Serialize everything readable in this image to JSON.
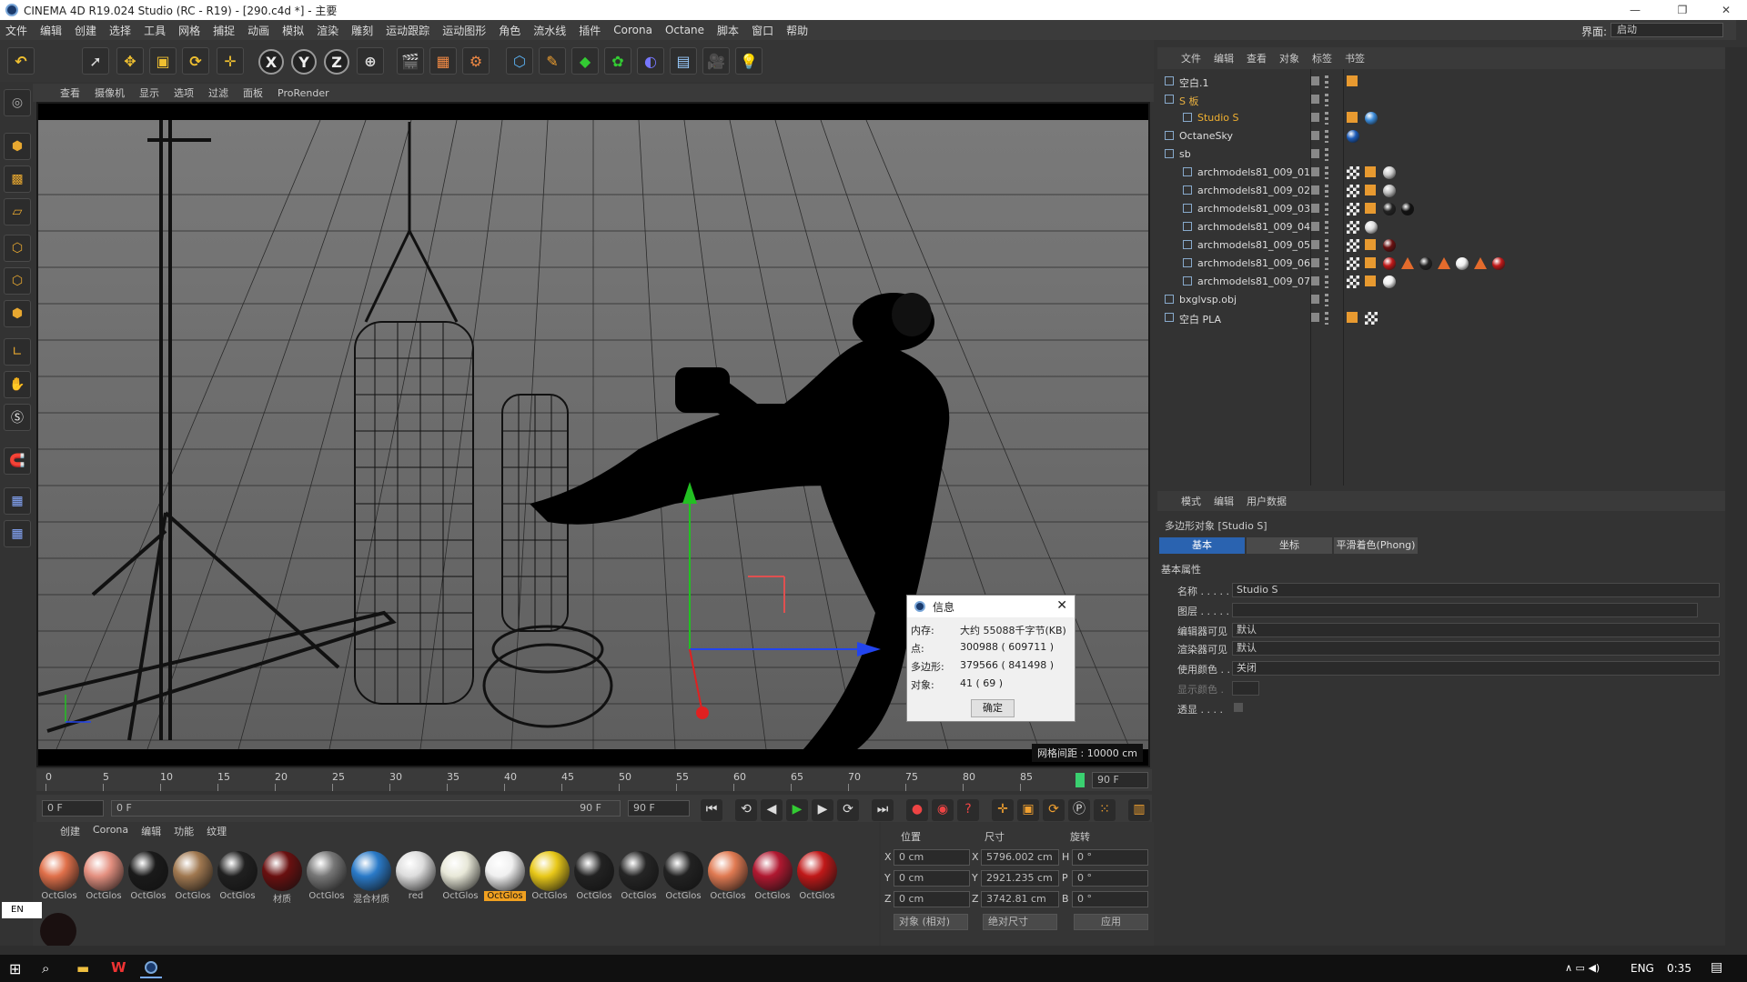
{
  "window": {
    "title": "CINEMA 4D R19.024 Studio (RC - R19) - [290.c4d *] - 主要"
  },
  "menubar": [
    "文件",
    "编辑",
    "创建",
    "选择",
    "工具",
    "网格",
    "捕捉",
    "动画",
    "模拟",
    "渲染",
    "雕刻",
    "运动跟踪",
    "运动图形",
    "角色",
    "流水线",
    "插件",
    "Corona",
    "Octane",
    "脚本",
    "窗口",
    "帮助"
  ],
  "interface": {
    "label": "界面:",
    "value": "启动"
  },
  "viewport_menu": [
    "查看",
    "摄像机",
    "显示",
    "选项",
    "过滤",
    "面板",
    "ProRender"
  ],
  "viewport": {
    "grid_status": "网格间距 : 10000 cm"
  },
  "timeline": {
    "ticks": [
      "0",
      "5",
      "10",
      "15",
      "20",
      "25",
      "30",
      "35",
      "40",
      "45",
      "50",
      "55",
      "60",
      "65",
      "70",
      "75",
      "80",
      "85"
    ],
    "end_frame": "90 F",
    "current": "0 F",
    "range_start": "0 F",
    "range_end": "90 F",
    "range_end2": "90 F"
  },
  "material_menu": [
    "创建",
    "Corona",
    "编辑",
    "功能",
    "纹理"
  ],
  "materials": [
    {
      "label": "OctGlos",
      "color": "#e0704a"
    },
    {
      "label": "OctGlos",
      "color": "#e49080"
    },
    {
      "label": "OctGlos",
      "color": "#1a1a1a"
    },
    {
      "label": "OctGlos",
      "color": "#a07850"
    },
    {
      "label": "OctGlos",
      "color": "#202020"
    },
    {
      "label": "材质",
      "color": "#6a1010"
    },
    {
      "label": "OctGlos",
      "color": "#777777"
    },
    {
      "label": "混合材质",
      "color": "#2a7ac8"
    },
    {
      "label": "red",
      "color": "#dddddd"
    },
    {
      "label": "OctGlos",
      "color": "#e8e8d8"
    },
    {
      "label": "OctGlos",
      "color": "#f0f0f0",
      "selected": true
    },
    {
      "label": "OctGlos",
      "color": "#e8c818"
    },
    {
      "label": "OctGlos",
      "color": "#222222"
    },
    {
      "label": "OctGlos",
      "color": "#252525"
    },
    {
      "label": "OctGlos",
      "color": "#222222"
    },
    {
      "label": "OctGlos",
      "color": "#e07a52"
    },
    {
      "label": "OctGlos",
      "color": "#b01830"
    },
    {
      "label": "OctGlos",
      "color": "#c01818"
    }
  ],
  "coords": {
    "headers": [
      "位置",
      "尺寸",
      "旋转"
    ],
    "rows": [
      {
        "axis": "X",
        "pos": "0 cm",
        "size_axis": "X",
        "size": "5796.002 cm",
        "rot_axis": "H",
        "rot": "0 °"
      },
      {
        "axis": "Y",
        "pos": "0 cm",
        "size_axis": "Y",
        "size": "2921.235 cm",
        "rot_axis": "P",
        "rot": "0 °"
      },
      {
        "axis": "Z",
        "pos": "0 cm",
        "size_axis": "Z",
        "size": "3742.81 cm",
        "rot_axis": "B",
        "rot": "0 °"
      }
    ],
    "mode": "对象 (相对)",
    "size_mode": "绝对尺寸",
    "apply": "应用"
  },
  "object_menu": [
    "文件",
    "编辑",
    "查看",
    "对象",
    "标签",
    "书签"
  ],
  "objects": [
    {
      "name": "空白.1",
      "indent": 0,
      "color": "#dddddd"
    },
    {
      "name": "S 板",
      "indent": 0,
      "color": "#e8b040"
    },
    {
      "name": "Studio S",
      "indent": 1,
      "color": "#f0b030"
    },
    {
      "name": "OctaneSky",
      "indent": 0,
      "color": "#dddddd"
    },
    {
      "name": "sb",
      "indent": 0,
      "color": "#dddddd"
    },
    {
      "name": "archmodels81_009_01",
      "indent": 1,
      "color": "#dddddd"
    },
    {
      "name": "archmodels81_009_02",
      "indent": 1,
      "color": "#dddddd"
    },
    {
      "name": "archmodels81_009_03",
      "indent": 1,
      "color": "#dddddd"
    },
    {
      "name": "archmodels81_009_04",
      "indent": 1,
      "color": "#dddddd"
    },
    {
      "name": "archmodels81_009_05",
      "indent": 1,
      "color": "#dddddd"
    },
    {
      "name": "archmodels81_009_06",
      "indent": 1,
      "color": "#dddddd"
    },
    {
      "name": "archmodels81_009_07",
      "indent": 1,
      "color": "#dddddd"
    },
    {
      "name": "bxglvsp.obj",
      "indent": 0,
      "color": "#dddddd"
    },
    {
      "name": "空白 PLA",
      "indent": 0,
      "color": "#dddddd"
    }
  ],
  "attr_menu": [
    "模式",
    "编辑",
    "用户数据"
  ],
  "attr": {
    "object_title": "多边形对象 [Studio S]",
    "tabs": [
      "基本",
      "坐标",
      "平滑着色(Phong)"
    ],
    "section": "基本属性",
    "name_label": "名称 . . . . .",
    "name_value": "Studio S",
    "layer_label": "图层 . . . . .",
    "editor_label": "编辑器可见",
    "editor_value": "默认",
    "render_label": "渲染器可见",
    "render_value": "默认",
    "usecolor_label": "使用颜色 . .",
    "usecolor_value": "关闭",
    "dispcolor_label": "显示颜色 .",
    "xray_label": "透显 . . . ."
  },
  "dialog": {
    "title": "信息",
    "rows": [
      {
        "k": "内存:",
        "v": "大约 55088千字节(KB)"
      },
      {
        "k": "点:",
        "v": "300988 ( 609711 )"
      },
      {
        "k": "多边形:",
        "v": "379566 ( 841498 )"
      },
      {
        "k": "对象:",
        "v": "41 ( 69 )"
      }
    ],
    "ok": "确定"
  },
  "ime": "EN",
  "taskbar": {
    "lang": "ENG",
    "time": "0:35"
  }
}
